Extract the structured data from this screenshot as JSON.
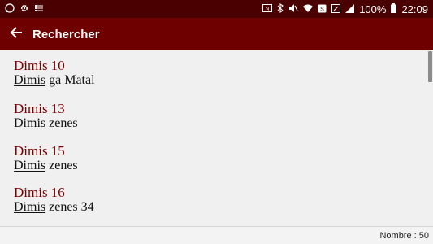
{
  "status_bar": {
    "left_icons": [
      "whatsapp-icon",
      "settings-gear-icon",
      "list-icon"
    ],
    "right_icons": [
      "nfc-icon",
      "bluetooth-icon",
      "mute-icon",
      "wifi-icon",
      "data-saver-icon",
      "sim-icon",
      "signal-icon",
      "battery-icon"
    ],
    "battery": "100%",
    "time": "22:09"
  },
  "app_bar": {
    "title": "Rechercher",
    "back_icon": "arrow-left-icon",
    "background": "#6f0000"
  },
  "results": [
    {
      "title": "Dimis 10",
      "match": "Dimis",
      "rest": " ga Matal"
    },
    {
      "title": "Dimis 13",
      "match": "Dimis",
      "rest": " zenes"
    },
    {
      "title": "Dimis 15",
      "match": "Dimis",
      "rest": " zenes"
    },
    {
      "title": "Dimis 16",
      "match": "Dimis",
      "rest": " zenes 34"
    }
  ],
  "footer": {
    "count_text": "Nombre : 50"
  },
  "colors": {
    "status_bar": "#4a0000",
    "accent": "#6f0000",
    "result_title": "#7a0000"
  }
}
